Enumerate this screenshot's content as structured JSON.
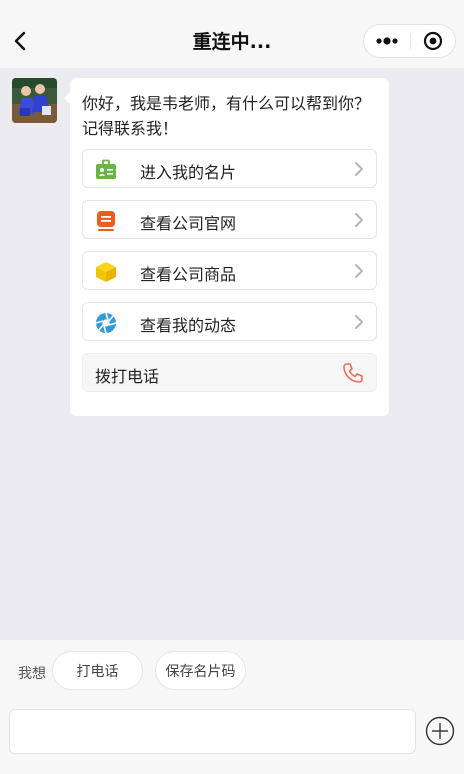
{
  "navbar": {
    "title": "重连中...",
    "back_icon": "chevron-left-icon",
    "more_icon": "more-dots-icon",
    "close_icon": "target-circle-icon"
  },
  "message": {
    "avatar_icon": "avatar-photo",
    "greeting": "你好，我是韦老师，有什么可以帮到你？记得联系我！",
    "menu": [
      {
        "label": "进入我的名片",
        "icon": "business-card-icon",
        "color": "#6bb545"
      },
      {
        "label": "查看公司官网",
        "icon": "website-icon",
        "color": "#f05a1a"
      },
      {
        "label": "查看公司商品",
        "icon": "product-box-icon",
        "color": "#f5c400"
      },
      {
        "label": "查看我的动态",
        "icon": "camera-aperture-icon",
        "color": "#2e9bd6"
      }
    ],
    "call": {
      "label": "拨打电话",
      "icon": "phone-icon",
      "color": "#e8705a"
    }
  },
  "bottom": {
    "want_label": "我想",
    "chips": [
      "打电话",
      "保存名片码"
    ],
    "input_placeholder": "",
    "plus_icon": "plus-circle-icon"
  }
}
